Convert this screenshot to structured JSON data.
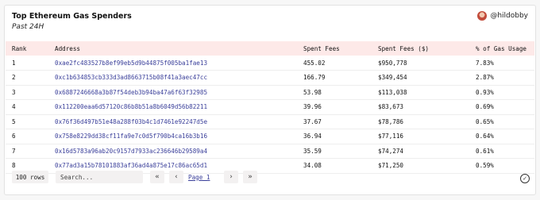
{
  "header": {
    "title": "Top Ethereum Gas Spenders",
    "subtitle": "Past 24H",
    "username": "@hildobby"
  },
  "table": {
    "columns": [
      "Rank",
      "Address",
      "Spent Fees",
      "Spent Fees ($)",
      "% of Gas Usage"
    ],
    "rows": [
      [
        "1",
        "0xae2fc483527b8ef99eb5d9b44875f005ba1fae13",
        "455.02",
        "$950,778",
        "7.83%"
      ],
      [
        "2",
        "0xc1b634853cb333d3ad8663715b08f41a3aec47cc",
        "166.79",
        "$349,454",
        "2.87%"
      ],
      [
        "3",
        "0x6887246668a3b87f54deb3b94ba47a6f63f32985",
        "53.98",
        "$113,038",
        "0.93%"
      ],
      [
        "4",
        "0x112200eaa6d57120c86b8b51a8b6049d56b82211",
        "39.96",
        "$83,673",
        "0.69%"
      ],
      [
        "5",
        "0x76f36d497b51e48a288f03b4c1d7461e92247d5e",
        "37.67",
        "$78,786",
        "0.65%"
      ],
      [
        "6",
        "0x758e8229dd38cf11fa9e7c0d5f790b4ca16b3b16",
        "36.94",
        "$77,116",
        "0.64%"
      ],
      [
        "7",
        "0x16d5783a96ab20c9157d7933ac236646b29589a4",
        "35.59",
        "$74,274",
        "0.61%"
      ],
      [
        "8",
        "0x77ad3a15b78101883af36ad4a875e17c86ac65d1",
        "34.08",
        "$71,250",
        "0.59%"
      ]
    ]
  },
  "footer": {
    "rows_label": "100 rows",
    "search_placeholder": "Search...",
    "page_label": "Page 1",
    "first_icon": "«",
    "prev_icon": "‹",
    "next_icon": "›",
    "last_icon": "»",
    "check_icon": "✓"
  },
  "colors": {
    "header_row_bg": "#fde9e8",
    "address_link": "#3a3f9a"
  }
}
